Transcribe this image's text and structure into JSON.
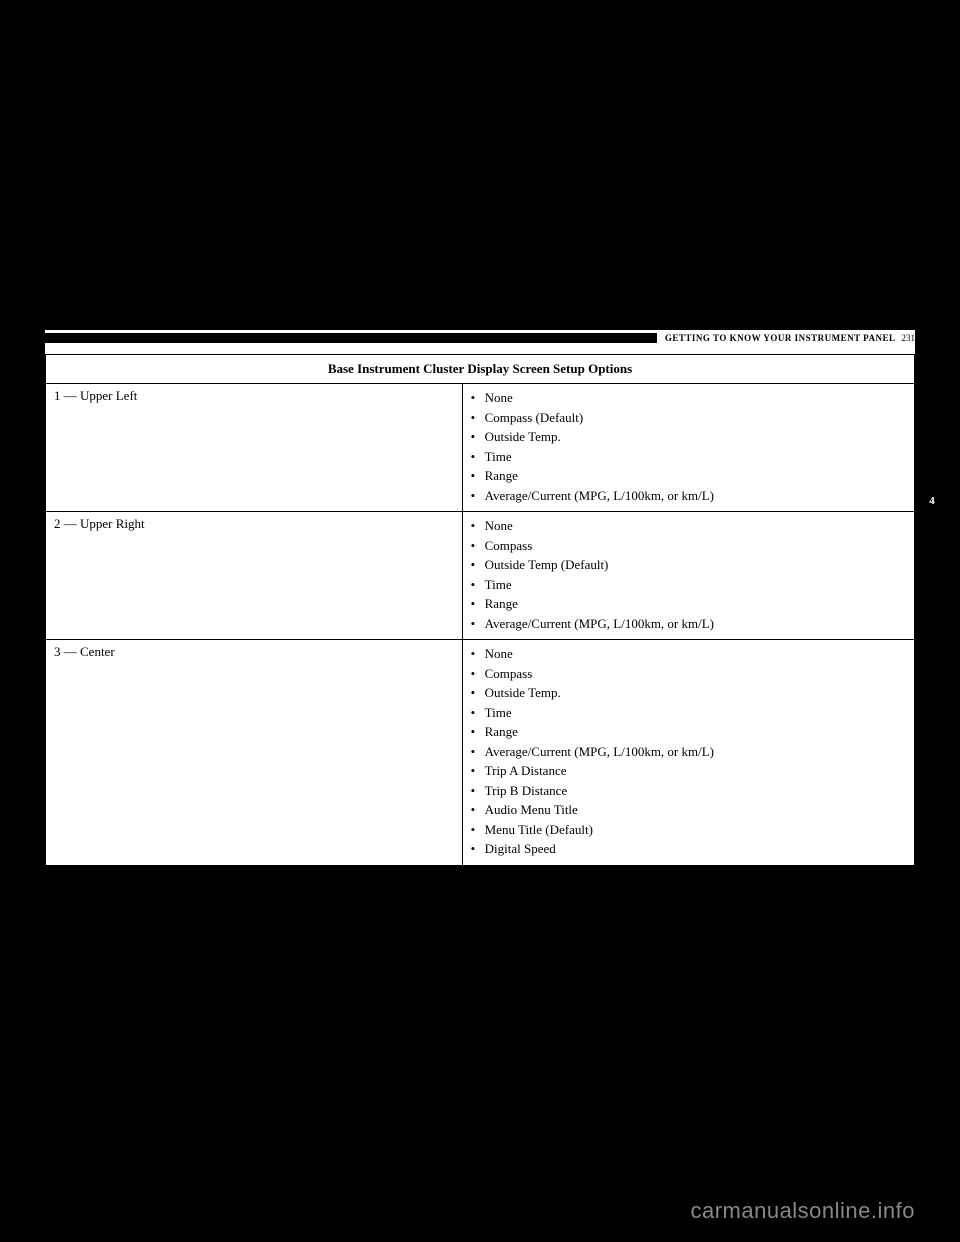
{
  "header": {
    "section": "GETTING TO KNOW YOUR INSTRUMENT PANEL",
    "page_number": "231"
  },
  "side_tab": "4",
  "table": {
    "title": "Base Instrument Cluster Display Screen Setup Options",
    "rows": [
      {
        "label": "1 — Upper Left",
        "items": [
          "None",
          "Compass (Default)",
          "Outside Temp.",
          "Time",
          "Range",
          "Average/Current (MPG, L/100km, or km/L)"
        ]
      },
      {
        "label": "2 — Upper Right",
        "items": [
          "None",
          "Compass",
          "Outside Temp (Default)",
          "Time",
          "Range",
          "Average/Current (MPG, L/100km, or km/L)"
        ]
      },
      {
        "label": "3 — Center",
        "items": [
          "None",
          "Compass",
          "Outside Temp.",
          "Time",
          "Range",
          "Average/Current (MPG, L/100km, or km/L)",
          "Trip A Distance",
          "Trip B Distance",
          "Audio Menu Title",
          "Menu Title (Default)",
          "Digital Speed"
        ]
      }
    ]
  },
  "watermark": "carmanualsonline.info"
}
